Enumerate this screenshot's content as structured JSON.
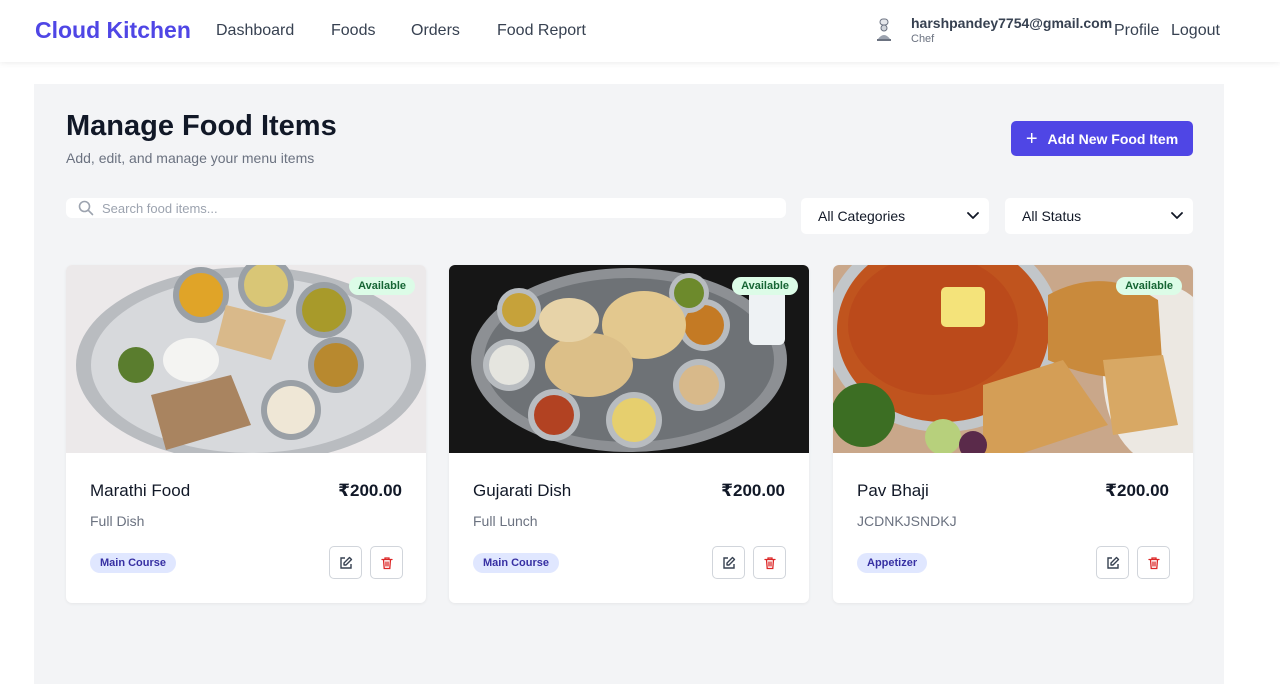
{
  "nav": {
    "brand": "Cloud Kitchen",
    "links": [
      "Dashboard",
      "Foods",
      "Orders",
      "Food Report"
    ],
    "user": {
      "email": "harshpandey7754@gmail.com",
      "role": "Chef"
    },
    "profile": "Profile",
    "logout": "Logout"
  },
  "page": {
    "title": "Manage Food Items",
    "subtitle": "Add, edit, and manage your menu items",
    "add_button": "Add New Food Item"
  },
  "filters": {
    "search_placeholder": "Search food items...",
    "category": "All Categories",
    "status": "All Status"
  },
  "foods": [
    {
      "name": "Marathi Food",
      "price": "₹200.00",
      "description": "Full Dish",
      "category": "Main Course",
      "status": "Available"
    },
    {
      "name": "Gujarati Dish",
      "price": "₹200.00",
      "description": "Full Lunch",
      "category": "Main Course",
      "status": "Available"
    },
    {
      "name": "Pav Bhaji",
      "price": "₹200.00",
      "description": "JCDNKJSNDKJ",
      "category": "Appetizer",
      "status": "Available"
    }
  ],
  "colors": {
    "accent": "#4f46e5",
    "available_bg": "#dcfce7",
    "category_bg": "#e0e7ff",
    "delete": "#dc2626"
  }
}
